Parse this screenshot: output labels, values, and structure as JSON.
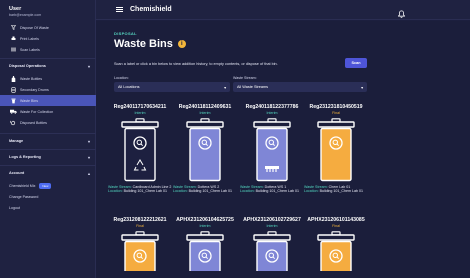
{
  "user": {
    "name": "User",
    "email": "barb@example.com"
  },
  "sidebar": {
    "top_items": [
      {
        "label": "Dispose Of Waste",
        "icon": "filter-icon"
      },
      {
        "label": "Print Labels",
        "icon": "printer-icon"
      },
      {
        "label": "Scan Labels",
        "icon": "barcode-icon"
      }
    ],
    "disposal_section": "Disposal Operations",
    "disposal_items": [
      {
        "label": "Waste Bottles",
        "icon": "bottle-icon"
      },
      {
        "label": "Secondary Drums",
        "icon": "drum-icon"
      },
      {
        "label": "Waste Bins",
        "icon": "bin-icon"
      },
      {
        "label": "Waste For Collection",
        "icon": "truck-icon"
      },
      {
        "label": "Disposed Bottles",
        "icon": "history-icon"
      }
    ],
    "sections": [
      "Manage",
      "Logs & Reporting",
      "Account"
    ],
    "account_items": [
      {
        "label": "Chemishield Mix",
        "badge": "New"
      },
      {
        "label": "Change Password"
      },
      {
        "label": "Logout"
      }
    ]
  },
  "topbar": {
    "title": "Chemishield"
  },
  "page": {
    "crumb": "DISPOSAL",
    "title": "Waste Bins",
    "instructions": "Scan a label or click a bin below to view addition history, to empty contents, or dispose of that bin.",
    "scan_button": "Scan",
    "location_label": "Location:",
    "location_value": "All Locations",
    "stream_label": "Waste Stream:",
    "stream_value": "All Waste Streams"
  },
  "colors": {
    "interim": "#53d7c0",
    "final": "#f3b33d",
    "bin_white": "#1d2040",
    "bin_purple": "#7f86d6",
    "bin_orange": "#f5ac40"
  },
  "bins": [
    {
      "id": "Reg240117170634211",
      "status": "Interim",
      "fill": "bin_white",
      "decor": "recycle-icon",
      "stream_k": "Waste Stream:",
      "stream": "Cardboard Admin Line 2",
      "loc_k": "Location:",
      "loc": "Building 101_Chem Lab 01"
    },
    {
      "id": "Reg240118112409631",
      "status": "Interim",
      "fill": "bin_purple",
      "decor": "",
      "stream_k": "Waste Stream:",
      "stream": "Dottera WS 2",
      "loc_k": "Location:",
      "loc": "Building 101_Chem Lab 01"
    },
    {
      "id": "Reg240118122377786",
      "status": "Interim",
      "fill": "bin_purple",
      "decor": "battery-icon",
      "stream_k": "Waste Stream:",
      "stream": "Dottera WS 1",
      "loc_k": "Location:",
      "loc": "Building 101_Chem Lab 01"
    },
    {
      "id": "Reg231231810450519",
      "status": "Final",
      "fill": "bin_orange",
      "decor": "",
      "stream_k": "Waste Stream:",
      "stream": "Chem Lab 01",
      "loc_k": "Location:",
      "loc": "Building 101_Chem Lab 01"
    },
    {
      "id": "Reg231208122212621",
      "status": "Final",
      "fill": "bin_orange"
    },
    {
      "id": "APHX231206104625725",
      "status": "Interim",
      "fill": "bin_purple"
    },
    {
      "id": "APHX231206102729627",
      "status": "Interim",
      "fill": "bin_purple"
    },
    {
      "id": "APHX231206101143085",
      "status": "Final",
      "fill": "bin_orange"
    }
  ]
}
